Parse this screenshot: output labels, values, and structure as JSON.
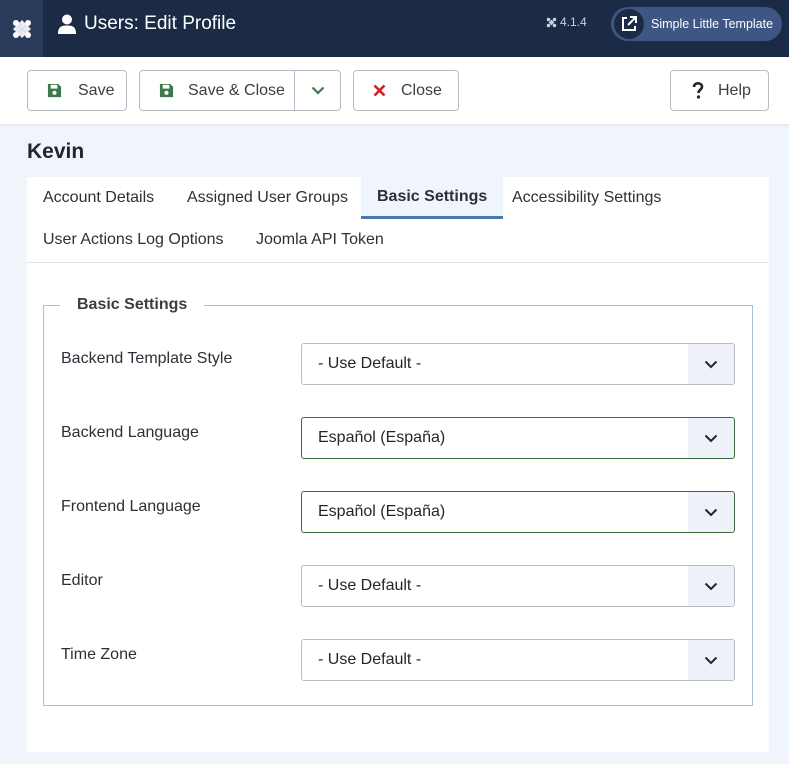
{
  "header": {
    "title": "Users: Edit Profile",
    "version": "4.1.4",
    "site_link_label": "Simple Little Template"
  },
  "toolbar": {
    "save_label": "Save",
    "save_close_label": "Save & Close",
    "close_label": "Close",
    "help_label": "Help"
  },
  "page": {
    "name": "Kevin"
  },
  "tabs": [
    {
      "label": "Account Details"
    },
    {
      "label": "Assigned User Groups"
    },
    {
      "label": "Basic Settings",
      "active": true
    },
    {
      "label": "Accessibility Settings"
    },
    {
      "label": "User Actions Log Options"
    },
    {
      "label": "Joomla API Token"
    }
  ],
  "fieldset": {
    "legend": "Basic Settings",
    "fields": [
      {
        "label": "Backend Template Style",
        "value": "- Use Default -"
      },
      {
        "label": "Backend Language",
        "value": "Español (España)"
      },
      {
        "label": "Frontend Language",
        "value": "Español (España)"
      },
      {
        "label": "Editor",
        "value": "- Use Default -"
      },
      {
        "label": "Time Zone",
        "value": "- Use Default -"
      }
    ]
  },
  "colors": {
    "header_bg": "#1c2b45",
    "save_icon": "#3d7a4a",
    "close_icon": "#c52827",
    "active_tab_border": "#4a79b0"
  },
  "icons": {
    "logo": "joomla-logo-icon",
    "user": "user-icon",
    "external": "external-link-icon",
    "save": "floppy-disk-icon",
    "close": "x-icon",
    "help": "question-mark-icon",
    "dropdown": "chevron-down-icon"
  }
}
